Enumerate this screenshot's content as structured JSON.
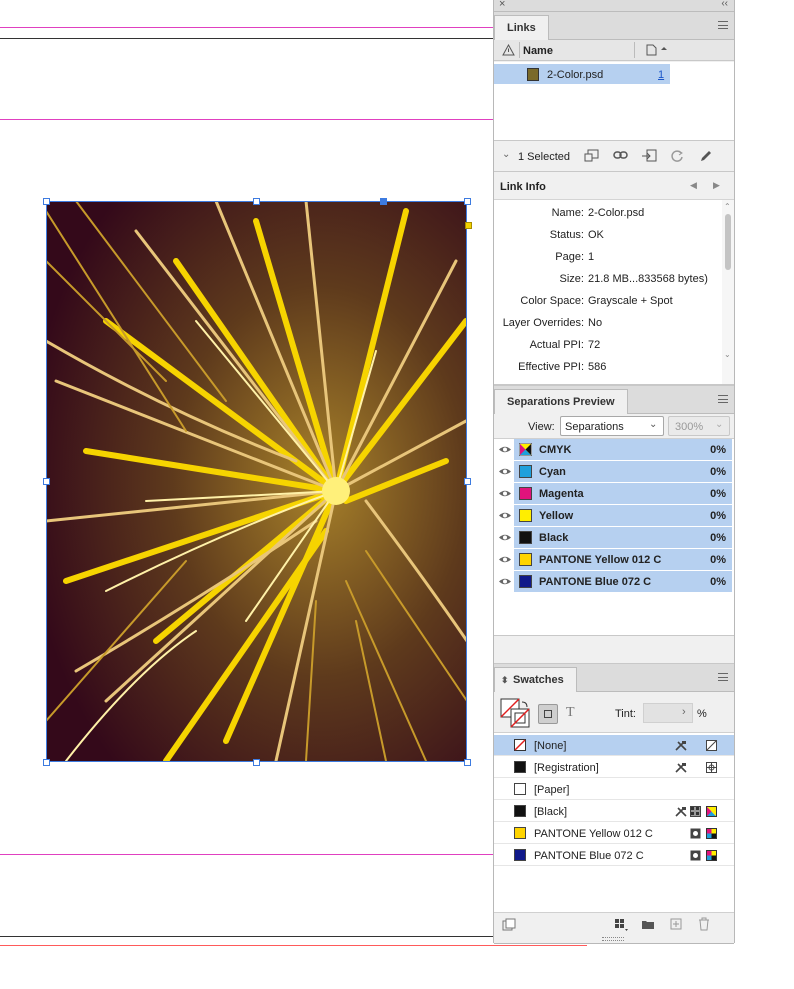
{
  "links": {
    "tab": "Links",
    "col_name": "Name",
    "file": {
      "name": "2-Color.psd",
      "page": "1"
    },
    "selected_count": "1 Selected"
  },
  "link_info": {
    "title": "Link Info",
    "fields": [
      {
        "label": "Name:",
        "value": "2-Color.psd"
      },
      {
        "label": "Status:",
        "value": "OK"
      },
      {
        "label": "Page:",
        "value": "1"
      },
      {
        "label": "Size:",
        "value": "21.8 MB...833568 bytes)"
      },
      {
        "label": "Color Space:",
        "value": "Grayscale + Spot"
      },
      {
        "label": "Layer Overrides:",
        "value": "No"
      },
      {
        "label": "Actual PPI:",
        "value": "72"
      },
      {
        "label": "Effective PPI:",
        "value": "586"
      }
    ]
  },
  "separations": {
    "tab": "Separations Preview",
    "view_label": "View:",
    "view_value": "Separations",
    "zoom": "300%",
    "items": [
      {
        "name": "CMYK",
        "value": "0%",
        "color": "cmyk"
      },
      {
        "name": "Cyan",
        "value": "0%",
        "color": "#1ea0dc"
      },
      {
        "name": "Magenta",
        "value": "0%",
        "color": "#e0137c"
      },
      {
        "name": "Yellow",
        "value": "0%",
        "color": "#ffee00"
      },
      {
        "name": "Black",
        "value": "0%",
        "color": "#111111"
      },
      {
        "name": "PANTONE Yellow 012 C",
        "value": "0%",
        "color": "#ffd400"
      },
      {
        "name": "PANTONE Blue 072 C",
        "value": "0%",
        "color": "#10198a"
      }
    ]
  },
  "swatches": {
    "tab": "Swatches",
    "tint_label": "Tint:",
    "tint_unit": "%",
    "items": [
      {
        "name": "[None]",
        "color": "none",
        "selected": true
      },
      {
        "name": "[Registration]",
        "color": "#111111"
      },
      {
        "name": "[Paper]",
        "color": "#ffffff"
      },
      {
        "name": "[Black]",
        "color": "#111111"
      },
      {
        "name": "PANTONE Yellow 012 C",
        "color": "#ffd400"
      },
      {
        "name": "PANTONE Blue 072 C",
        "color": "#10198a"
      }
    ]
  }
}
